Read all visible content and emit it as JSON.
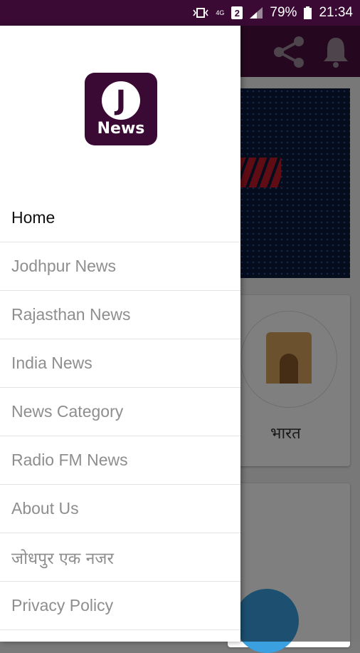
{
  "status_bar": {
    "network": "4G",
    "sim": "2",
    "battery": "79%",
    "time": "21:34"
  },
  "background": {
    "category_label": "भारत"
  },
  "drawer": {
    "logo_letter": "J",
    "logo_text": "News",
    "items": [
      {
        "label": "Home"
      },
      {
        "label": "Jodhpur News"
      },
      {
        "label": "Rajasthan News"
      },
      {
        "label": "India News"
      },
      {
        "label": "News Category"
      },
      {
        "label": "Radio FM News"
      },
      {
        "label": "About Us"
      },
      {
        "label": "जोधपुर एक नजर"
      },
      {
        "label": "Privacy Policy"
      }
    ]
  },
  "colors": {
    "brand": "#3a0a35",
    "active_text": "#111111",
    "inactive_text": "#8e8e8e"
  }
}
